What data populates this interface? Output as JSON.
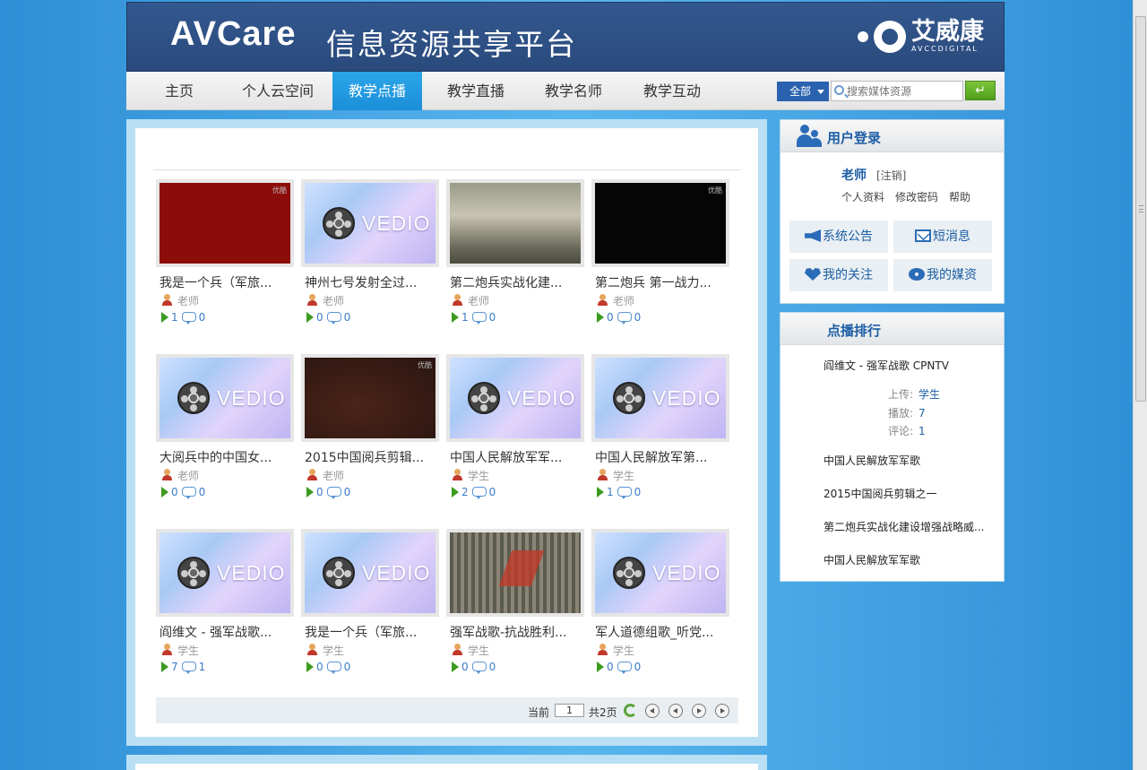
{
  "header": {
    "logo_en": "AVCare",
    "title": "信息资源共享平台",
    "brand_cn": "艾威康",
    "brand_en": "AVCCDIGITAL"
  },
  "nav": {
    "items": [
      {
        "label": "主页",
        "active": false
      },
      {
        "label": "个人云空间",
        "active": false
      },
      {
        "label": "教学点播",
        "active": true
      },
      {
        "label": "教学直播",
        "active": false
      },
      {
        "label": "教学名师",
        "active": false
      },
      {
        "label": "教学互动",
        "active": false
      }
    ]
  },
  "search": {
    "category": "全部",
    "placeholder": "搜索媒体资源",
    "go_icon": "enter-icon",
    "go_glyph": "↵"
  },
  "videos": [
    {
      "title": "我是一个兵（军旅...",
      "author": "老师",
      "plays": "1",
      "comments": "0",
      "thumb": "red",
      "watermark": "优酷"
    },
    {
      "title": "神州七号发射全过...",
      "author": "老师",
      "plays": "0",
      "comments": "0",
      "thumb": "vedio"
    },
    {
      "title": "第二炮兵实战化建...",
      "author": "老师",
      "plays": "1",
      "comments": "0",
      "thumb": "smoke"
    },
    {
      "title": "第二炮兵 第一战力...",
      "author": "老师",
      "plays": "0",
      "comments": "0",
      "thumb": "black",
      "watermark": "优酷"
    },
    {
      "title": "大阅兵中的中国女...",
      "author": "老师",
      "plays": "0",
      "comments": "0",
      "thumb": "vedio"
    },
    {
      "title": "2015中国阅兵剪辑...",
      "author": "老师",
      "plays": "0",
      "comments": "0",
      "thumb": "brown",
      "watermark": "优酷"
    },
    {
      "title": "中国人民解放军军...",
      "author": "学生",
      "plays": "2",
      "comments": "0",
      "thumb": "vedio"
    },
    {
      "title": "中国人民解放军第...",
      "author": "学生",
      "plays": "1",
      "comments": "0",
      "thumb": "vedio"
    },
    {
      "title": "阎维文 - 强军战歌...",
      "author": "学生",
      "plays": "7",
      "comments": "1",
      "thumb": "vedio"
    },
    {
      "title": "我是一个兵（军旅...",
      "author": "学生",
      "plays": "0",
      "comments": "0",
      "thumb": "vedio"
    },
    {
      "title": "强军战歌-抗战胜利...",
      "author": "学生",
      "plays": "0",
      "comments": "0",
      "thumb": "parade"
    },
    {
      "title": "军人道德组歌_听党...",
      "author": "学生",
      "plays": "0",
      "comments": "0",
      "thumb": "vedio"
    }
  ],
  "vedio_label": "VEDIO",
  "pager": {
    "current_label": "当前",
    "current_page": "1",
    "total_label": "共2页"
  },
  "login": {
    "title": "用户登录",
    "username": "老师",
    "logout": "[注销]",
    "links": [
      "个人资料",
      "修改密码",
      "帮助"
    ],
    "buttons": [
      {
        "label": "系统公告",
        "icon": "megaphone-icon"
      },
      {
        "label": "短消息",
        "icon": "mail-icon"
      },
      {
        "label": "我的关注",
        "icon": "heart-icon"
      },
      {
        "label": "我的媒资",
        "icon": "film-reel-icon"
      }
    ]
  },
  "ranking": {
    "title": "点播排行",
    "top": {
      "title": "阎维文 - 强军战歌 CPNTV",
      "upload_label": "上传:",
      "upload_value": "学生",
      "plays_label": "播放:",
      "plays_value": "7",
      "comments_label": "评论:",
      "comments_value": "1"
    },
    "items": [
      "中国人民解放军军歌",
      "2015中国阅兵剪辑之一",
      "第二炮兵实战化建设增强战略威...",
      "中国人民解放军军歌"
    ]
  },
  "colors": {
    "header_bg": "#2f5288",
    "nav_active": "#1e95dd",
    "accent_text": "#1d5ea5",
    "page_bg": "#4aa9e8"
  }
}
